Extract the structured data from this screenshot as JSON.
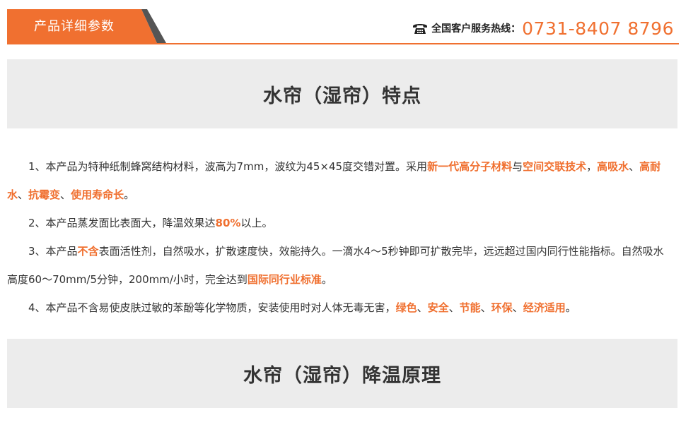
{
  "header": {
    "tab_label": "产品详细参数",
    "hotline_label": "全国客户服务热线：",
    "hotline_number": "0731-8407 8796",
    "phone_icon": "telephone-icon",
    "accent_color": "#f07030"
  },
  "sections": [
    {
      "title": "水帘（湿帘）特点"
    },
    {
      "title": "水帘（湿帘）降温原理"
    }
  ],
  "paragraphs": [
    {
      "segments": [
        {
          "text": "1、本产品为特种纸制蜂窝结构材料，波高为7mm，波纹为45×45度交错对置。采用",
          "hl": false
        },
        {
          "text": "新一代高分子材料",
          "hl": true
        },
        {
          "text": "与",
          "hl": false
        },
        {
          "text": "空间交联技术",
          "hl": true
        },
        {
          "text": "，",
          "hl": false
        },
        {
          "text": "高吸水",
          "hl": true
        },
        {
          "text": "、",
          "hl": false
        },
        {
          "text": "高耐水",
          "hl": true
        },
        {
          "text": "、",
          "hl": false
        },
        {
          "text": "抗霉变",
          "hl": true
        },
        {
          "text": "、",
          "hl": false
        },
        {
          "text": "使用寿命长",
          "hl": true
        },
        {
          "text": "。",
          "hl": false
        }
      ]
    },
    {
      "segments": [
        {
          "text": "2、本产品蒸发面比表面大，降温效果达",
          "hl": false
        },
        {
          "text": "80%",
          "hl": true
        },
        {
          "text": "以上。",
          "hl": false
        }
      ]
    },
    {
      "segments": [
        {
          "text": "3、本产品",
          "hl": false
        },
        {
          "text": "不含",
          "hl": true
        },
        {
          "text": "表面活性剂，自然吸水，扩散速度快，效能持久。一滴水4～5秒钟即可扩散完毕，远远超过国内同行性能指标。自然吸水高度60～70mm/5分钟，200mm/小时，完全达到",
          "hl": false
        },
        {
          "text": "国际同行业标准",
          "hl": true
        },
        {
          "text": "。",
          "hl": false
        }
      ]
    },
    {
      "segments": [
        {
          "text": "4、本产品不含易使皮肤过敏的苯酚等化学物质，安装使用时对人体无毒无害，",
          "hl": false
        },
        {
          "text": "绿色",
          "hl": true
        },
        {
          "text": "、",
          "hl": false
        },
        {
          "text": "安全",
          "hl": true
        },
        {
          "text": "、",
          "hl": false
        },
        {
          "text": "节能",
          "hl": true
        },
        {
          "text": "、",
          "hl": false
        },
        {
          "text": "环保",
          "hl": true
        },
        {
          "text": "、",
          "hl": false
        },
        {
          "text": "经济适用",
          "hl": true
        },
        {
          "text": "。",
          "hl": false
        }
      ]
    }
  ]
}
